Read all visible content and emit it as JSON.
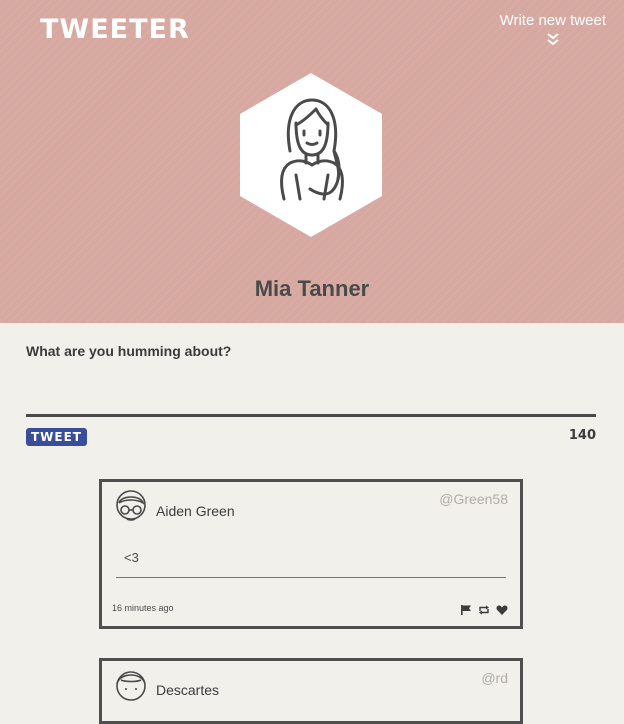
{
  "app": {
    "logo": "TWEETER",
    "write_new_label": "Write new tweet"
  },
  "profile": {
    "name": "Mia Tanner"
  },
  "composer": {
    "label": "What are you humming about?",
    "value": "",
    "button_label": "TWEET",
    "counter": "140"
  },
  "tweets": [
    {
      "name": "Aiden Green",
      "handle": "@Green58",
      "text": "<3",
      "time": "16 minutes ago",
      "actions": [
        "flag-icon",
        "retweet-icon",
        "heart-icon"
      ]
    },
    {
      "name": "Descartes",
      "handle": "@rd",
      "text": "",
      "time": "",
      "actions": []
    }
  ],
  "colors": {
    "header_bg": "#d6a8a0",
    "page_bg": "#f2f0eb",
    "button_bg": "#3a4d9a",
    "text_dark": "#4a4a4a"
  }
}
